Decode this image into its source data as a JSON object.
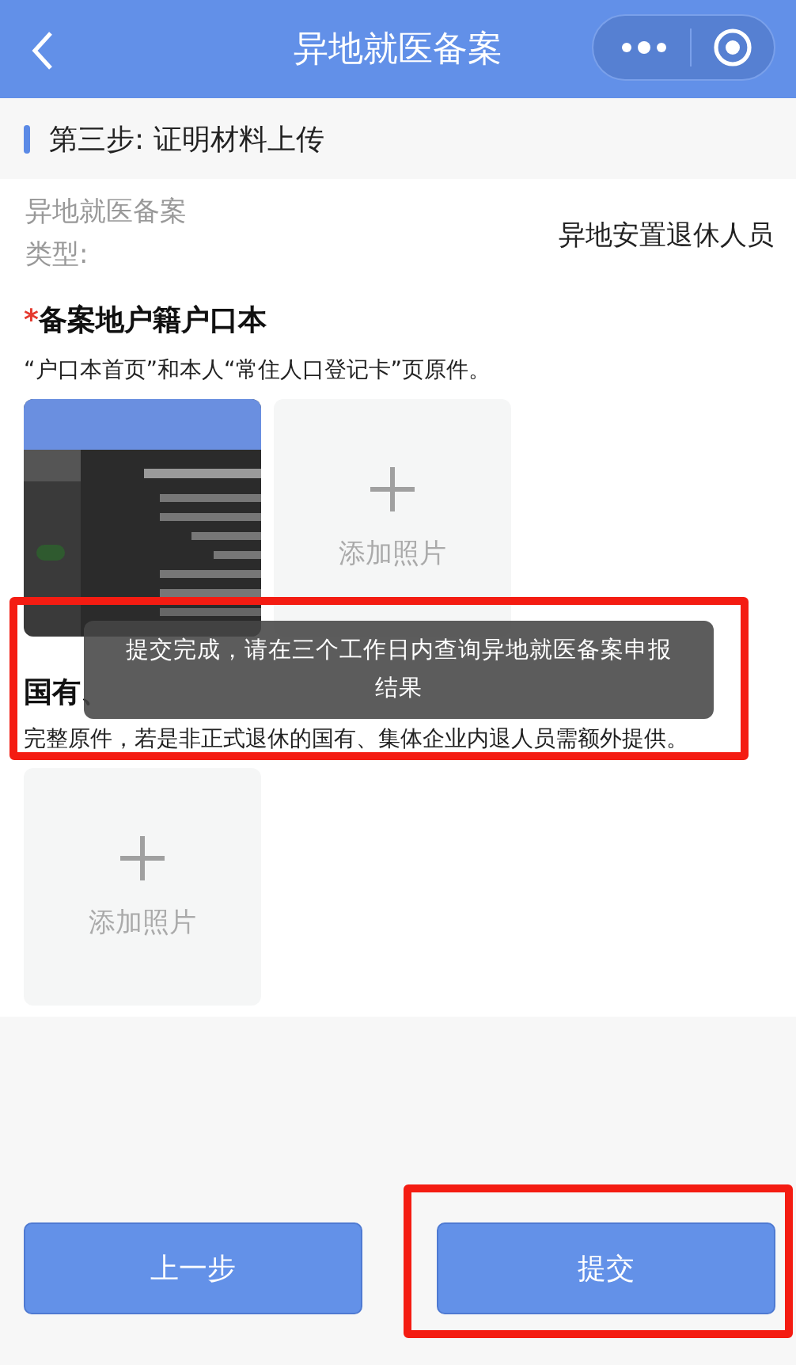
{
  "header": {
    "title": "异地就医备案"
  },
  "step": {
    "label": "第三步: 证明材料上传"
  },
  "record_type": {
    "label": "异地就医备案类型:",
    "value": "异地安置退休人员"
  },
  "sections": [
    {
      "title": "备案地户籍户口本",
      "required_mark": "*",
      "description": "“户口本首页”和本人“常住人口登记卡”页原件。",
      "tiles": [
        {
          "kind": "picture"
        },
        {
          "kind": "add",
          "label": "添加照片"
        }
      ]
    },
    {
      "title": "国有、",
      "description": "完整原件，若是非正式退休的国有、集体企业内退人员需额外提供。",
      "tiles": [
        {
          "kind": "add",
          "label": "添加照片"
        }
      ]
    }
  ],
  "buttons": [
    {
      "label": "上一步",
      "highlighted": false
    },
    {
      "label": "提交",
      "highlighted": true
    }
  ],
  "toast": {
    "message": "提交完成，请在三个工作日内查询异地就医备案申报结果",
    "highlighted": true
  }
}
